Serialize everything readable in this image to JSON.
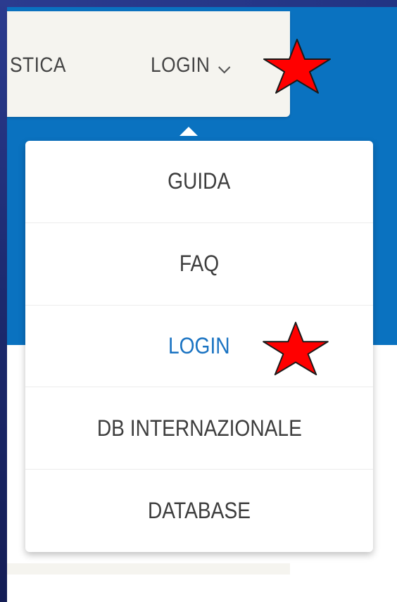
{
  "navbar": {
    "partial_item_label": "STICA",
    "login_label": "LOGIN",
    "login_chevron_icon": "chevron-down-icon"
  },
  "dropdown": {
    "items": [
      {
        "label": "GUIDA",
        "active": false
      },
      {
        "label": "FAQ",
        "active": false
      },
      {
        "label": "LOGIN",
        "active": true
      },
      {
        "label": "DB INTERNAZIONALE",
        "active": false
      },
      {
        "label": "DATABASE",
        "active": false
      }
    ]
  },
  "annotations": {
    "marker_icon": "red-star-icon"
  },
  "colors": {
    "header_blue": "#0a72c0",
    "navbar_bg": "#f5f4ef",
    "active_link": "#1a73c2",
    "text": "#3d3d3d",
    "star_fill": "#ff0000"
  }
}
